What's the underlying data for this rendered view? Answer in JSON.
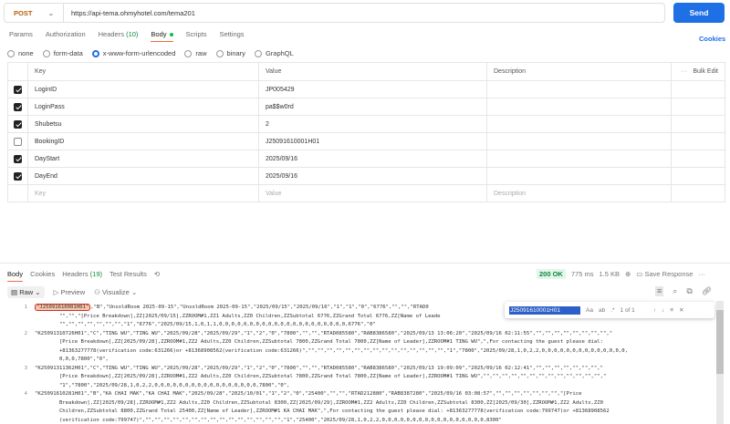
{
  "request": {
    "method": "POST",
    "url": "https://api-tema.ohmyhotel.com/tema201",
    "send_label": "Send",
    "cookies_label": "Cookies"
  },
  "tabs": [
    "Params",
    "Authorization",
    "Headers",
    "(10)",
    "Body",
    "Scripts",
    "Settings"
  ],
  "body_types": [
    "none",
    "form-data",
    "x-www-form-urlencoded",
    "raw",
    "binary",
    "GraphQL"
  ],
  "table": {
    "headers": {
      "key": "Key",
      "value": "Value",
      "description": "Description",
      "bulk_edit": "Bulk Edit"
    },
    "rows": [
      {
        "checked": true,
        "key": "LoginID",
        "value": "JP005429"
      },
      {
        "checked": true,
        "key": "LoginPass",
        "value": "pa$$w0rd"
      },
      {
        "checked": true,
        "key": "Shubetsu",
        "value": "2"
      },
      {
        "checked": false,
        "key": "BookingID",
        "value": "J25091610001H01"
      },
      {
        "checked": true,
        "key": "DayStart",
        "value": "2025/09/16"
      },
      {
        "checked": true,
        "key": "DayEnd",
        "value": "2025/09/16"
      }
    ],
    "placeholder": {
      "key": "Key",
      "value": "Value",
      "description": "Description"
    }
  },
  "response": {
    "tabs": [
      "Body",
      "Cookies",
      "Headers",
      "(19)",
      "Test Results"
    ],
    "status": "200 OK",
    "time": "775 ms",
    "size": "1.5 KB",
    "save_label": "Save Response",
    "format": "Raw",
    "preview": "Preview",
    "visualize": "Visualize",
    "find": {
      "query": "J25091610001H01",
      "count": "1 of 1",
      "case": "Aa",
      "word": "ab",
      "regex": ".*"
    },
    "highlight": "\"J25091610001H01\"",
    "lines": [
      {
        "num": "1",
        "text": [
          ",\"B\",\"UnsoldRoom 2025-09-15\",\"UnsoldRoom 2025-09-15\",\"2025/09/15\",\"2025/09/16\",\"1\",\"1\",\"0\",\"6776\",\"\",\"\",\"RTAD0",
          "        \"\",\"\",\"[Price Breakdown],ZZ[2025/09/15],ZZROOM#1,ZZ1 Adults,ZZ0 Children,ZZSubtotal 6776,ZZGrand Total 6776,ZZ[Name of Leade",
          "        \"\",\"\",\"\",\"\",\"\",\"\",\"\",\"1\",\"6776\",\"2025/09/15,1,0,1,1,0,0,0,0,0,0,0,0,0,0,0,0,0,0,0,0,0,0,0,0,0,6776\",\"0\""
        ]
      },
      {
        "num": "2",
        "text": [
          "\"K25091310726H01\",\"C\",\"TING WU\",\"TING WU\",\"2025/09/28\",\"2025/09/29\",\"1\",\"2\",\"0\",\"7800\",\"\",\"\",\"RTAD085580\",\"RAB8386580\",\"2025/09/13 13:06:20\",\"2025/09/16 02:11:55\",\"\",\"\",\"\",\"\",\"\",\"\",\"\",\"\",\"",
          "        [Price Breakdown],ZZ[2025/09/28],ZZROOM#1,ZZ2 Adults,ZZ0 Children,ZZSubtotal 7800,ZZGrand Total 7800,ZZ[Name of Leader],ZZROOM#1 TING WU\",\",For contacting the guest please dial:",
          "        +81363277778(verification code:631266)or +81368908562(verification code:631266)\",\"\",\"\",\"\",\"\",\"\",\"\",\"\",\"\",\"\",\"\",\"\",\"\",\"\",\"\",\"\",\"1\",\"7800\",\"2025/09/28,1,0,2,2,0,0,0,0,0,0,0,0,0,0,0,0,0,0,",
          "        0,0,0,7800\",\"0\","
        ]
      },
      {
        "num": "3",
        "text": [
          "\"K25091311362H01\",\"C\",\"TING WU\",\"TING WU\",\"2025/09/28\",\"2025/09/29\",\"1\",\"2\",\"0\",\"7800\",\"\",\"\",\"RTAD085580\",\"RAB8386580\",\"2025/09/13 19:09:09\",\"2025/09/16 02:12:41\",\"\",\"\",\"\",\"\",\"\",\"\",\"\",\"",
          "        [Price Breakdown],ZZ[2025/09/28],ZZROOM#1,ZZ2 Adults,ZZ0 Children,ZZSubtotal 7800,ZZGrand Total 7800,ZZ[Name of Leader],ZZROOM#1 TING WU\",\"\",\"\",\"\",\"\",\"\",\"\",\"\",\"\",\"\",\"\",\"\",\"\",\"\",\"",
          "        \"1\",\"7800\",\"2025/09/28,1,0,2,2,0,0,0,0,0,0,0,0,0,0,0,0,0,0,0,0,0,7800\",\"0\","
        ]
      },
      {
        "num": "4",
        "text": [
          "\"K25091610281H01\",\"B\",\"KA CHAI MAK\",\"KA CHAI MAK\",\"2025/09/28\",\"2025/10/01\",\"1\",\"2\",\"0\",\"25400\",\"\",\"\",\"RTAD212880\",\"RAB8387280\",\"2025/09/16 03:08:57\",\"\",\"\",\"\",\"\",\"\",\"\",\"\",\"[Price",
          "        Breakdown],ZZ[2025/09/28],ZZROOM#1,ZZ2 Adults,ZZ0 Children,ZZSubtotal 8300,ZZ[2025/09/29],ZZROOM#1,ZZ2 Adults,ZZ0 Children,ZZSubtotal 8300,ZZ[2025/09/30],ZZROOM#1,ZZ2 Adults,ZZ0",
          "        Children,ZZSubtotal 8800,ZZGrand Total 25400,ZZ[Name of Leader],ZZROOM#1 KA CHAI MAK\",\",For contacting the guest please dial: +81363277778(verification code:799747)or +81368908562",
          "        (verification code:799747)\",\"\",\"\",\"\",\"\",\"\",\"\",\"\",\"\",\"\",\"\",\"\",\"\",\"\",\"\",\"\",\"1\",\"25400\",\"2025/09/28,1,0,2,2,0,0,0,0,0,0,0,0,0,0,0,0,0,0,0,0,0,8300\""
        ]
      }
    ]
  },
  "colors": {
    "accent": "#1f6fe5",
    "status_ok": "#0a8a3c",
    "highlight": "#d3302f"
  }
}
